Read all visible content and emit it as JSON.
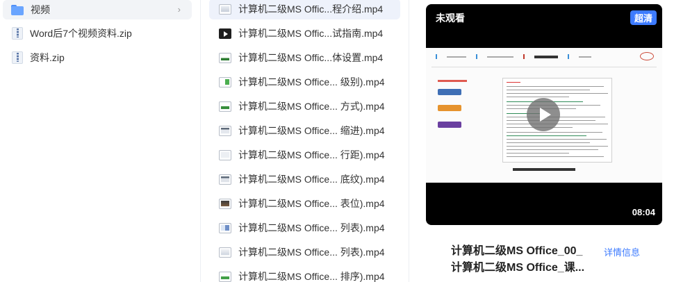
{
  "left_panel": {
    "items": [
      {
        "label": "视频",
        "type": "folder",
        "icon": "folder-icon",
        "selected": true
      },
      {
        "label": "Word后7个视频资料.zip",
        "type": "zip",
        "icon": "zip-file-icon"
      },
      {
        "label": "资料.zip",
        "type": "zip",
        "icon": "zip-file-icon"
      }
    ]
  },
  "file_list": {
    "items": [
      {
        "name": "计算机二级MS Offic...程介绍.mp4",
        "thumb": "light",
        "active": true
      },
      {
        "name": "计算机二级MS Offic...试指南.mp4",
        "thumb": "dark"
      },
      {
        "name": "计算机二级MS Offic...体设置.mp4",
        "thumb": "green"
      },
      {
        "name": "计算机二级MS Office... 级别).mp4",
        "thumb": "green"
      },
      {
        "name": "计算机二级MS Office... 方式).mp4",
        "thumb": "green"
      },
      {
        "name": "计算机二级MS Office... 缩进).mp4",
        "thumb": "gray"
      },
      {
        "name": "计算机二级MS Office... 行距).mp4",
        "thumb": "light"
      },
      {
        "name": "计算机二级MS Office... 底纹).mp4",
        "thumb": "gray"
      },
      {
        "name": "计算机二级MS Office... 表位).mp4",
        "thumb": "brown"
      },
      {
        "name": "计算机二级MS Office... 列表).mp4",
        "thumb": "blue"
      },
      {
        "name": "计算机二级MS Office... 列表).mp4",
        "thumb": "light"
      },
      {
        "name": "计算机二级MS Office... 排序).mp4",
        "thumb": "green"
      }
    ]
  },
  "preview": {
    "watch_status": "未观看",
    "quality": "超清",
    "duration": "08:04",
    "title_line1": "计算机二级MS Office_00_",
    "title_line2": "计算机二级MS Office_课...",
    "detail_link": "详情信息"
  },
  "colors": {
    "accent": "#3d7bff",
    "selected_bg": "#f2f4f7",
    "active_row_bg": "#eef2fb"
  }
}
